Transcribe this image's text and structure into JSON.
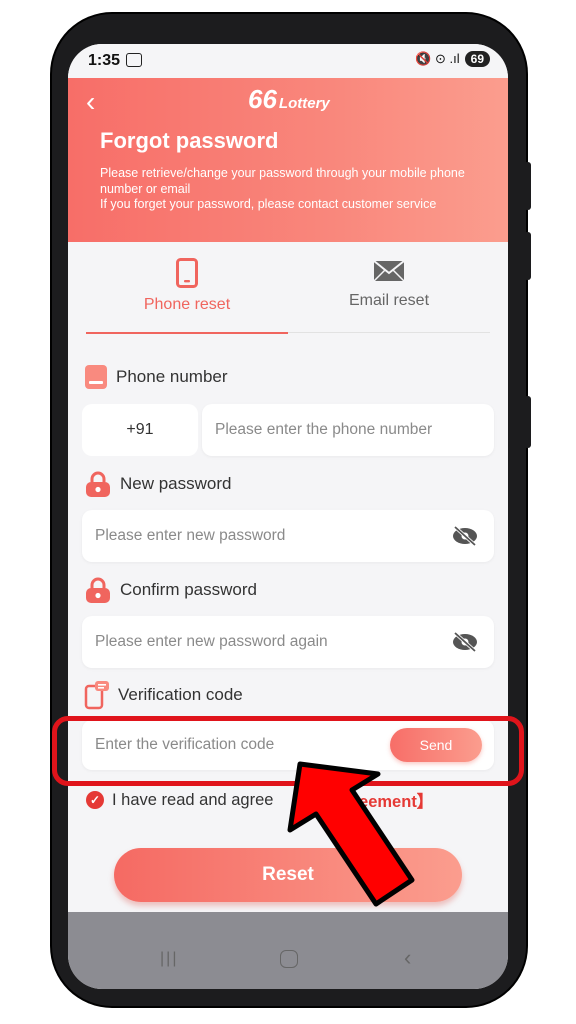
{
  "status_bar": {
    "time": "1:35",
    "signal_text": "🔇 ⊙ .ıl",
    "battery": "69"
  },
  "header": {
    "back_icon": "chevron-left-icon",
    "logo_main": "66",
    "logo_sub": "Lottery",
    "title": "Forgot password",
    "description": "Please retrieve/change your password through your mobile phone number or email\nIf you forget your password, please contact customer service"
  },
  "tabs": [
    {
      "label": "Phone reset",
      "icon": "phone-icon",
      "active": true
    },
    {
      "label": "Email reset",
      "icon": "envelope-icon",
      "active": false
    }
  ],
  "form": {
    "phone": {
      "label": "Phone number",
      "country_code": "+91",
      "placeholder": "Please enter the phone number"
    },
    "new_password": {
      "label": "New password",
      "placeholder": "Please enter new password"
    },
    "confirm_password": {
      "label": "Confirm password",
      "placeholder": "Please enter new password again"
    },
    "verification": {
      "label": "Verification code",
      "placeholder": "Enter the verification code",
      "send_label": "Send"
    },
    "agreement": {
      "text": "I have read and agree",
      "link": "y Agreement】"
    },
    "reset_label": "Reset"
  },
  "colors": {
    "accent": "#f0655e",
    "highlight": "#e0141b",
    "arrow": "#ff0000"
  }
}
